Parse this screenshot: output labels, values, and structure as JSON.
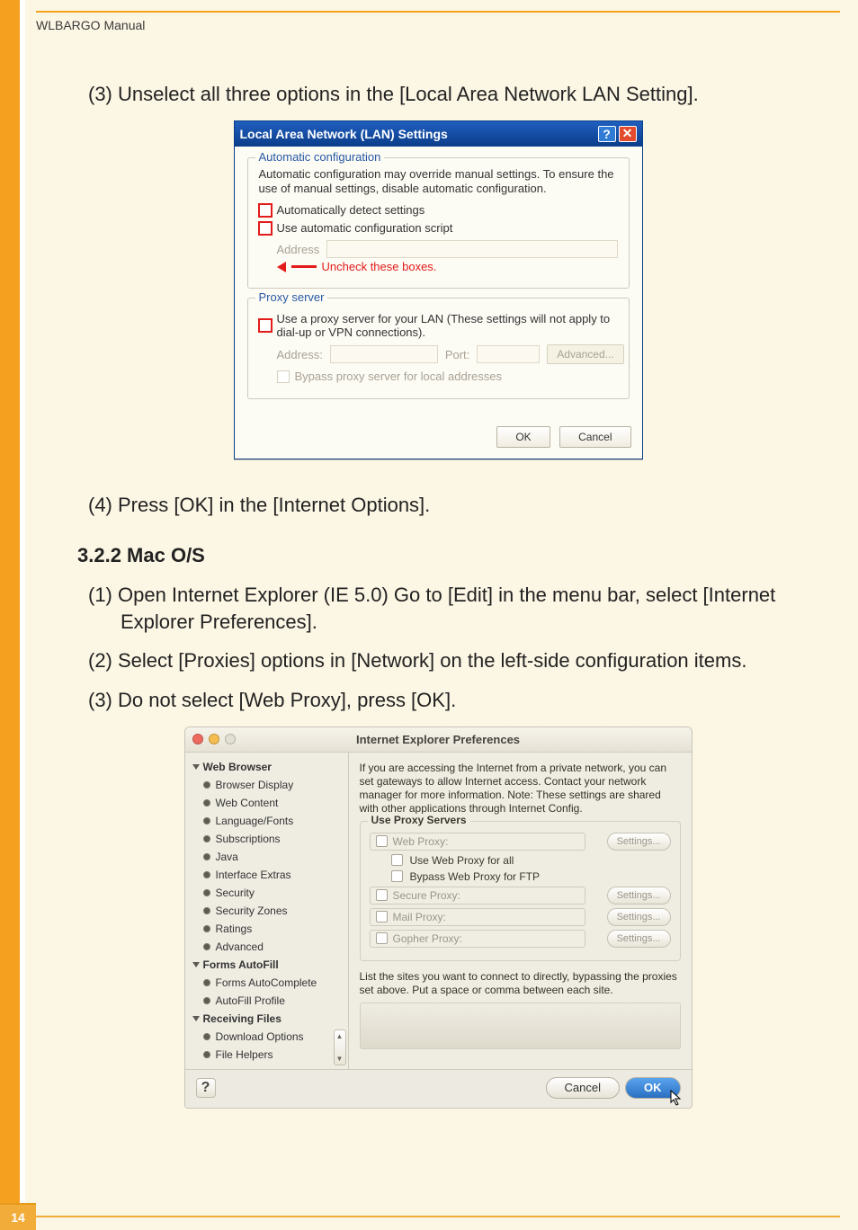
{
  "header": "WLBARGO Manual",
  "page_number": "14",
  "steps": {
    "s3": "(3) Unselect all three options in the  [Local Area Network LAN Setting].",
    "s4": "(4) Press [OK] in the [Internet Options].",
    "mac_head": "3.2.2 Mac O/S",
    "m1a": "(1) Open Internet Explorer (IE 5.0) Go to [Edit] in the menu bar, select [Internet",
    "m1b": "Explorer Preferences].",
    "m2": "(2) Select [Proxies] options in [Network] on the left-side configuration items.",
    "m3": "(3) Do not select [Web Proxy], press [OK]."
  },
  "lan": {
    "title": "Local Area Network (LAN) Settings",
    "g1_title": "Automatic configuration",
    "g1_desc": "Automatic configuration may override manual settings.  To ensure the use of manual settings, disable automatic configuration.",
    "auto_detect": "Automatically detect settings",
    "auto_script": "Use automatic configuration script",
    "addr_lbl": "Address",
    "annot": "Uncheck these boxes.",
    "g2_title": "Proxy server",
    "g2_desc": "Use a proxy server for your LAN (These settings will not apply to dial-up or VPN connections).",
    "addr2": "Address:",
    "port": "Port:",
    "advanced": "Advanced...",
    "bypass": "Bypass proxy server for local addresses",
    "ok": "OK",
    "cancel": "Cancel"
  },
  "mac": {
    "title": "Internet Explorer Preferences",
    "desc": "If you are accessing the Internet from a private network, you can set gateways to allow Internet access.  Contact your network manager for more information.  Note: These settings are shared with other applications through Internet Config.",
    "group_title": "Use Proxy Servers",
    "web_proxy": "Web Proxy:",
    "use_all": "Use Web Proxy for all",
    "bypass_ftp": "Bypass Web Proxy for FTP",
    "secure": "Secure Proxy:",
    "mail": "Mail Proxy:",
    "gopher": "Gopher Proxy:",
    "settings": "Settings...",
    "list_desc": "List the sites you want to connect to directly,  bypassing the proxies set above.  Put a space or comma between each site.",
    "cancel": "Cancel",
    "ok": "OK",
    "sidebar": {
      "g1": "Web Browser",
      "i1": "Browser Display",
      "i2": "Web Content",
      "i3": "Language/Fonts",
      "i4": "Subscriptions",
      "i5": "Java",
      "i6": "Interface Extras",
      "i7": "Security",
      "i8": "Security Zones",
      "i9": "Ratings",
      "i10": "Advanced",
      "g2": "Forms AutoFill",
      "i11": "Forms AutoComplete",
      "i12": "AutoFill Profile",
      "g3": "Receiving Files",
      "i13": "Download Options",
      "i14": "File Helpers"
    }
  }
}
